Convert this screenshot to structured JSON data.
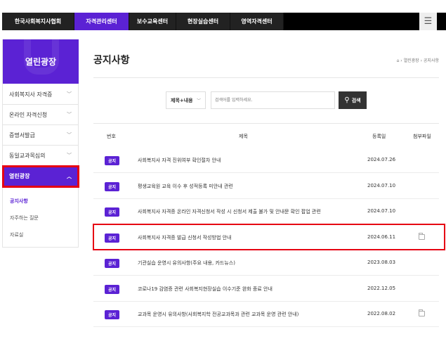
{
  "topnav": {
    "tabs": [
      "한국사회복지사협회",
      "자격관리센터",
      "보수교육센터",
      "현장실습센터",
      "영역자격센터"
    ],
    "active_index": 1,
    "menu_icon": "hamburger-icon"
  },
  "sidebar": {
    "title": "열린광장",
    "items": [
      {
        "label": "사회복지사 자격증",
        "expanded": false
      },
      {
        "label": "온라인 자격신청",
        "expanded": false
      },
      {
        "label": "증명서발급",
        "expanded": false
      },
      {
        "label": "동일교과목심의",
        "expanded": false
      },
      {
        "label": "열린광장",
        "expanded": true
      }
    ],
    "subitems": [
      {
        "label": "공지사항",
        "active": true
      },
      {
        "label": "자주하는 질문",
        "active": false
      },
      {
        "label": "자료실",
        "active": false
      }
    ]
  },
  "main": {
    "title": "공지사항",
    "breadcrumb": "⌂ › 열린광장 › 공지사항",
    "search": {
      "select_value": "제목+내용",
      "placeholder": "검색어를 입력하세요.",
      "button_label": "검색"
    },
    "table": {
      "headers": [
        "번호",
        "제목",
        "등록일",
        "첨부파일"
      ],
      "rows": [
        {
          "badge": "공지",
          "title": "사회복지사 자격 진위여부 확인절차 안내",
          "date": "2024.07.26",
          "attachment": false
        },
        {
          "badge": "공지",
          "title": "평생교육원 교육 이수 후 성적등록 미안내 관련",
          "date": "2024.07.10",
          "attachment": false
        },
        {
          "badge": "공지",
          "title": "사회복지사 자격증 온라인 자격신청서 작성 시 신청서 제출 불가 및 안내문 확인 팝업 관련",
          "date": "2024.07.10",
          "attachment": false
        },
        {
          "badge": "공지",
          "title": "사회복지사 자격증 발급 신청서 작성방법 안내",
          "date": "2024.06.11",
          "attachment": true
        },
        {
          "badge": "공지",
          "title": "기관실습 운영시 유의사항(주요 내용, 카드뉴스)",
          "date": "2023.08.03",
          "attachment": false
        },
        {
          "badge": "공지",
          "title": "코로나19 감염증 관련 사회복지현장실습 이수기준 완화 종료 안내",
          "date": "2022.12.05",
          "attachment": false
        },
        {
          "badge": "공지",
          "title": "교과목 운영시 유의사항(사회복지학 전공교과목과 관련 교과목 운영 관련 안내)",
          "date": "2022.08.02",
          "attachment": true
        }
      ]
    }
  },
  "colors": {
    "accent": "#5b22d4",
    "highlight": "#e60012",
    "topbar": "#222222"
  }
}
